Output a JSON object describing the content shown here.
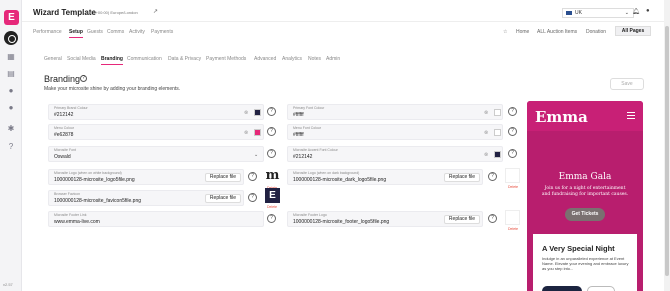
{
  "app": {
    "logo_letter": "E",
    "version": "v2.57"
  },
  "header": {
    "title": "Wizard Template",
    "subtitle": "(UTC+00:00) Europe/London",
    "country": "UK"
  },
  "main_tabs": [
    {
      "label": "Performance"
    },
    {
      "label": "Setup"
    },
    {
      "label": "Guests"
    },
    {
      "label": "Comms"
    },
    {
      "label": "Activity"
    },
    {
      "label": "Payments"
    }
  ],
  "page_links": [
    "Home",
    "ALL Auction Items",
    "Donation"
  ],
  "all_pages_label": "All Pages",
  "sub_tabs": [
    {
      "label": "General"
    },
    {
      "label": "Social Media"
    },
    {
      "label": "Branding"
    },
    {
      "label": "Communication"
    },
    {
      "label": "Data & Privacy"
    },
    {
      "label": "Payment Methods"
    },
    {
      "label": "Advanced"
    },
    {
      "label": "Analytics"
    },
    {
      "label": "Notes"
    },
    {
      "label": "Admin"
    }
  ],
  "section": {
    "title": "Branding",
    "description": "Make your microsite shine by adding your branding elements.",
    "save_label": "Save"
  },
  "fields": {
    "primary_brand": {
      "label": "Primary Brand Colour",
      "value": "#212142",
      "swatch": "#212142"
    },
    "primary_font": {
      "label": "Primary Font Colour",
      "value": "#ffffff",
      "swatch": "#ffffff"
    },
    "menu_colour": {
      "label": "Menu Colour",
      "value": "#e62878",
      "swatch": "#e62878"
    },
    "menu_font": {
      "label": "Menu Font Colour",
      "value": "#ffffff",
      "swatch": "#ffffff"
    },
    "microsite_font": {
      "label": "Microsite Font",
      "value": "Oswald"
    },
    "accent_font": {
      "label": "Microsite Accent Font Colour",
      "value": "#212142",
      "swatch": "#212142"
    },
    "logo_white": {
      "label": "Microsite Logo (when on white background)",
      "value": "1000000128-microsite_logo5file.png",
      "button": "Replace file",
      "thumb_text": "m",
      "delete": "Delete"
    },
    "logo_dark": {
      "label": "Microsite Logo (when on dark background)",
      "value": "1000000128-microsite_dark_logo5file.png",
      "button": "Replace file",
      "delete": "Delete"
    },
    "browser_favicon": {
      "label": "Browser Favicon",
      "value": "1000000128-microsite_favicon5file.png",
      "button": "Replace file",
      "thumb_text": "E",
      "delete": "Delete"
    },
    "footer_logo": {
      "label": "Microsite Footer Logo",
      "value": "1000000128-microsite_footer_logo5file.png",
      "button": "Replace file",
      "delete": "Delete"
    },
    "footer_link": {
      "label": "Microsite Footer Link",
      "value": "www.emma-live.com"
    }
  },
  "preview": {
    "logo": "Emma",
    "title": "Emma Gala",
    "subtitle": "Join us for a night of entertainment and fundraising for important causes.",
    "cta": "Get Tickets",
    "card_title": "A Very Special Night",
    "card_text": "Indulge in an unparalleled experience at Event Name. Elevate your evening and embrace luxury as you step into..."
  },
  "colors": {
    "accent": "#e62878",
    "preview_bg": "#c82076"
  }
}
